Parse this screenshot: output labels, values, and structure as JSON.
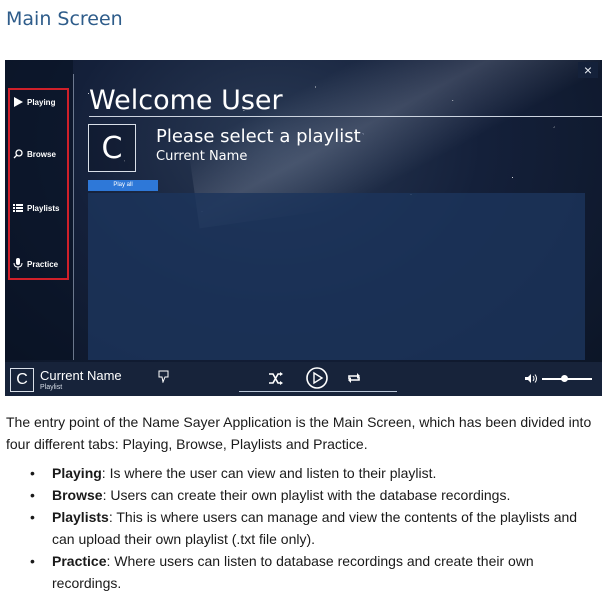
{
  "heading": "Main Screen",
  "app": {
    "close_glyph": "×",
    "nav": [
      {
        "label": "Playing",
        "icon": "play-icon"
      },
      {
        "label": "Browse",
        "icon": "search-icon"
      },
      {
        "label": "Playlists",
        "icon": "list-icon"
      },
      {
        "label": "Practice",
        "icon": "microphone-icon"
      }
    ],
    "welcome": "Welcome User",
    "avatar_letter": "C",
    "playlist_title": "Please select a playlist",
    "playlist_sub": "Current Name",
    "play_all": "Play all",
    "now_playing": {
      "avatar_letter": "C",
      "name": "Current Name",
      "sub": "Playlist"
    },
    "colors": {
      "highlight_border": "#d0202a",
      "play_all_bg": "#2e78d8",
      "heading": "#2e5c8a"
    }
  },
  "doc": {
    "paragraph": "The entry point of the Name Sayer Application is the Main Screen, which has been divided into four different tabs: Playing, Browse, Playlists and Practice.",
    "bullets": [
      {
        "term": "Playing",
        "text": ": Is where the user can view and listen to their playlist."
      },
      {
        "term": "Browse",
        "text": ": Users can create their own playlist with the database recordings."
      },
      {
        "term": "Playlists",
        "text": ": This is where users can manage and view the contents of the playlists and can upload their own playlist (.txt file only)."
      },
      {
        "term": "Practice",
        "text": ": Where users can listen to database recordings and create their own recordings."
      }
    ]
  }
}
